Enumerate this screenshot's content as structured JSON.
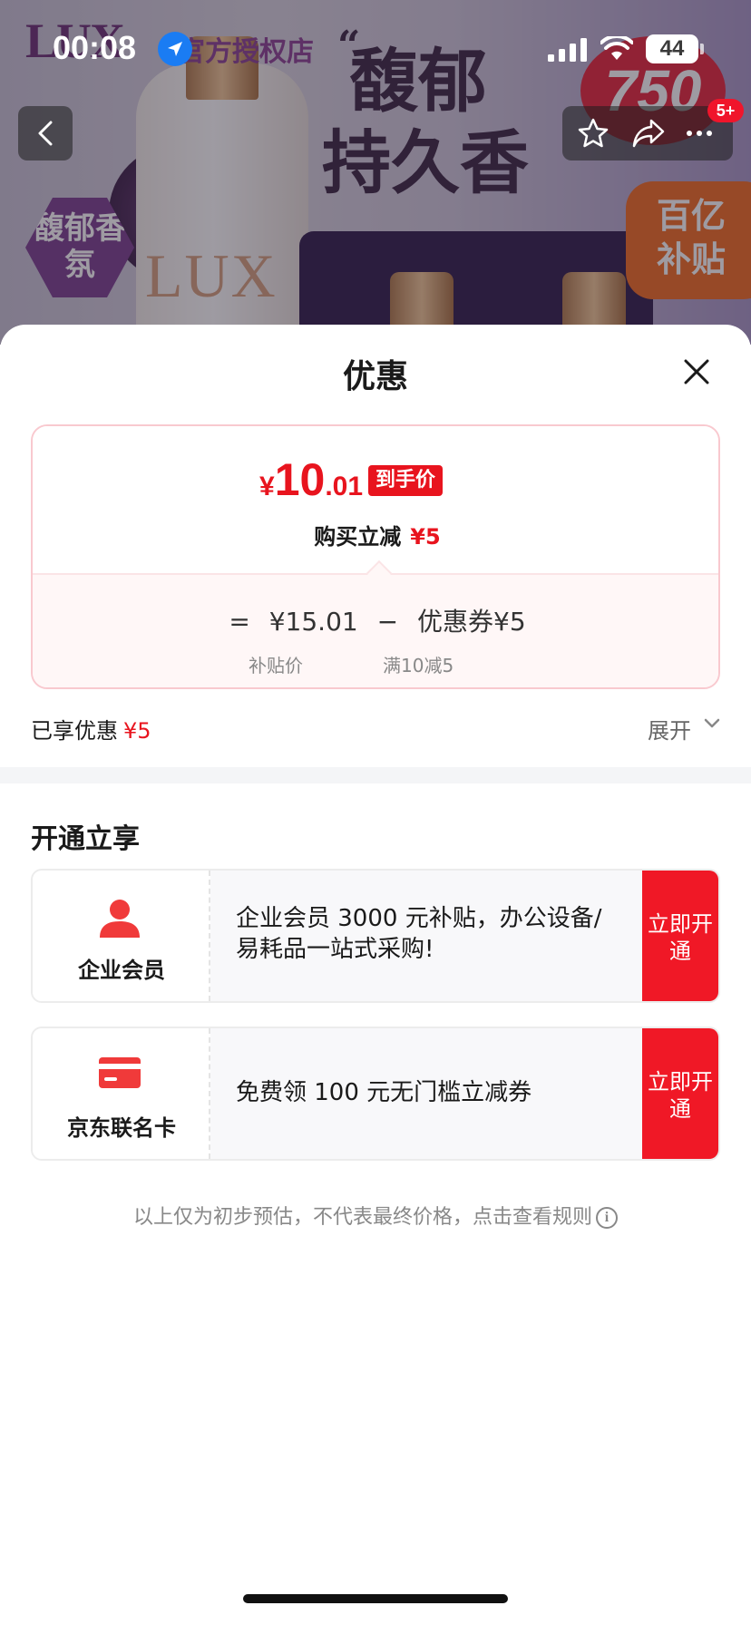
{
  "status_bar": {
    "time": "00:08",
    "battery": "44"
  },
  "banner": {
    "brand_logo": "LUX",
    "store_name": "官方授权店",
    "slogan_line1": "馥郁",
    "slogan_line2": "持久香",
    "badge_text": "馥郁香氛",
    "size_badge": "750",
    "subsidy_tag_line1": "百亿",
    "subsidy_tag_line2": "补贴",
    "more_badge": "5+"
  },
  "sheet": {
    "title": "优惠",
    "price": {
      "currency": "¥",
      "integer": "10",
      "decimal": ".01",
      "tag": "到手价",
      "instant_cut_label": "购买立减",
      "instant_cut_amount": "¥5",
      "eq_sign": "=",
      "base_price": "¥15.01",
      "minus_sign": "−",
      "coupon_label": "优惠券¥5",
      "base_price_caption": "补贴价",
      "coupon_caption": "满10减5"
    },
    "enjoyed": {
      "label": "已享优惠",
      "amount": "¥5"
    },
    "expand_label": "展开",
    "section_title": "开通立享",
    "offers": [
      {
        "name": "企业会员",
        "icon": "person-icon",
        "desc": "企业会员 3000 元补贴，办公设备/易耗品一站式采购!",
        "button": "立即开通"
      },
      {
        "name": "京东联名卡",
        "icon": "card-icon",
        "desc": "免费领 100 元无门槛立减券",
        "button": "立即开通"
      }
    ],
    "disclaimer": "以上仅为初步预估，不代表最终价格，点击查看规则"
  },
  "colors": {
    "accent_red": "#e8141e",
    "button_red": "#f01826",
    "card_border": "#f9c9cf"
  }
}
